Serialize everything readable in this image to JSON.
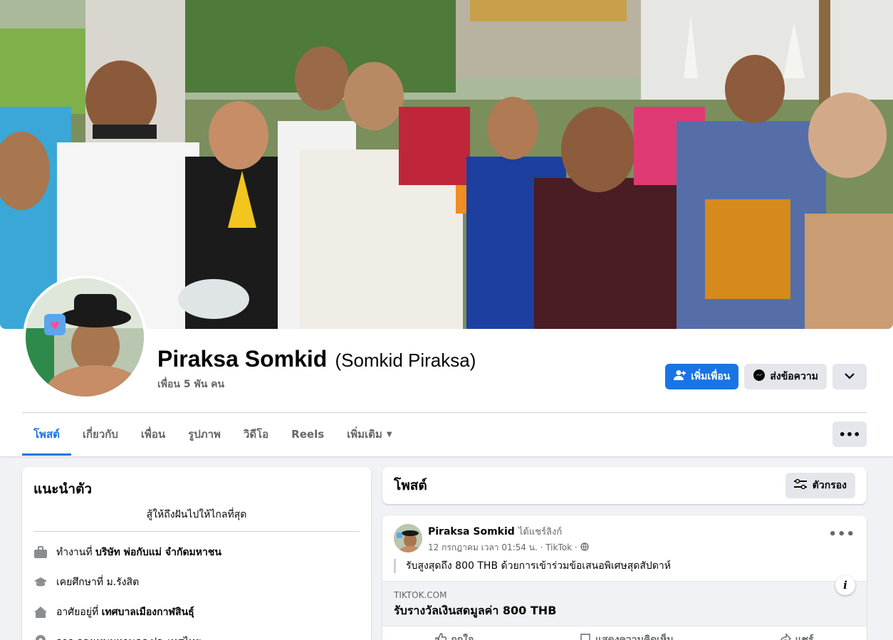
{
  "profile": {
    "name": "Piraksa Somkid",
    "alt_name": "(Somkid Piraksa)",
    "friends": "เพื่อน 5 พัน คน"
  },
  "actions": {
    "add_friend": "เพิ่มเพื่อน",
    "message": "ส่งข้อความ"
  },
  "tabs": [
    {
      "label": "โพสต์",
      "active": true
    },
    {
      "label": "เกี่ยวกับ"
    },
    {
      "label": "เพื่อน"
    },
    {
      "label": "รูปภาพ"
    },
    {
      "label": "วิดีโอ"
    },
    {
      "label": "Reels"
    },
    {
      "label": "เพิ่มเติม"
    }
  ],
  "intro": {
    "title": "แนะนำตัว",
    "bio": "สู้ให้ถึงฝันไปให้ไกลที่สุด",
    "work_prefix": "ทำงานที่",
    "work_value": "บริษัท พ่อกับแม่ จำกัดมหาชน",
    "study_prefix": "เคยศึกษาที่",
    "study_value": "ม.รังสิต",
    "live_prefix": "อาศัยอยู่ที่",
    "live_value": "เทศบาลเมืองกาฬสินธุ์",
    "from_text": "จาก กรุงเทพมหานคร ประเทศไทย"
  },
  "posts_header": {
    "title": "โพสต์",
    "filter": "ตัวกรอง"
  },
  "post": {
    "author": "Piraksa Somkid",
    "action": "ได้แชร์ลิงก์",
    "time": "12 กรกฎาคม เวลา 01:54 น. · TikTok ·",
    "text": "รับสูงสุดถึง 800 THB ด้วยการเข้าร่วมข้อเสนอพิเศษสุดสัปดาห์",
    "link_domain": "TIKTOK.COM",
    "link_title": "รับรางวัลเงินสดมูลค่า 800 THB",
    "like": "ถูกใจ",
    "comment": "แสดงความคิดเห็น",
    "share": "แชร์"
  },
  "colors": {
    "accent": "#1b74e4",
    "secondary_bg": "#e4e6eb",
    "page_bg": "#f0f2f5"
  }
}
